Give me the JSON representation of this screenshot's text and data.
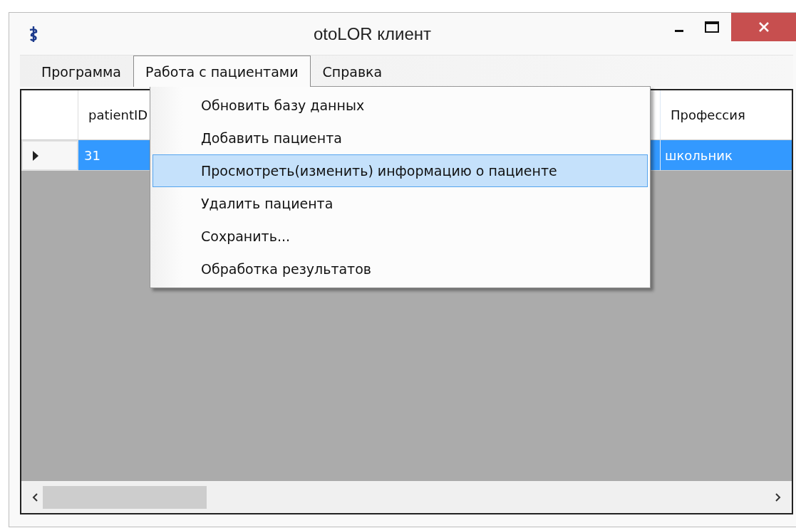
{
  "window": {
    "title": "otoLOR клиент"
  },
  "menu_bar": [
    {
      "label": "Программа",
      "selected": false
    },
    {
      "label": "Работа с пациентами",
      "selected": true
    },
    {
      "label": "Справка",
      "selected": false
    }
  ],
  "dropdown_menu": [
    {
      "label": "Обновить базу данных",
      "selected": false
    },
    {
      "label": "Добавить пациента",
      "selected": false
    },
    {
      "label": "Просмотреть(изменить) информацию о пациенте",
      "selected": true
    },
    {
      "label": "Удалить пациента",
      "selected": false
    },
    {
      "label": "Сохранить...",
      "selected": false
    },
    {
      "label": "Обработка результатов",
      "selected": false
    }
  ],
  "table": {
    "columns": [
      "patientID",
      "Профессия"
    ],
    "rows": [
      {
        "cells": [
          "31",
          "школьник"
        ],
        "selected": true,
        "current": true
      }
    ]
  }
}
